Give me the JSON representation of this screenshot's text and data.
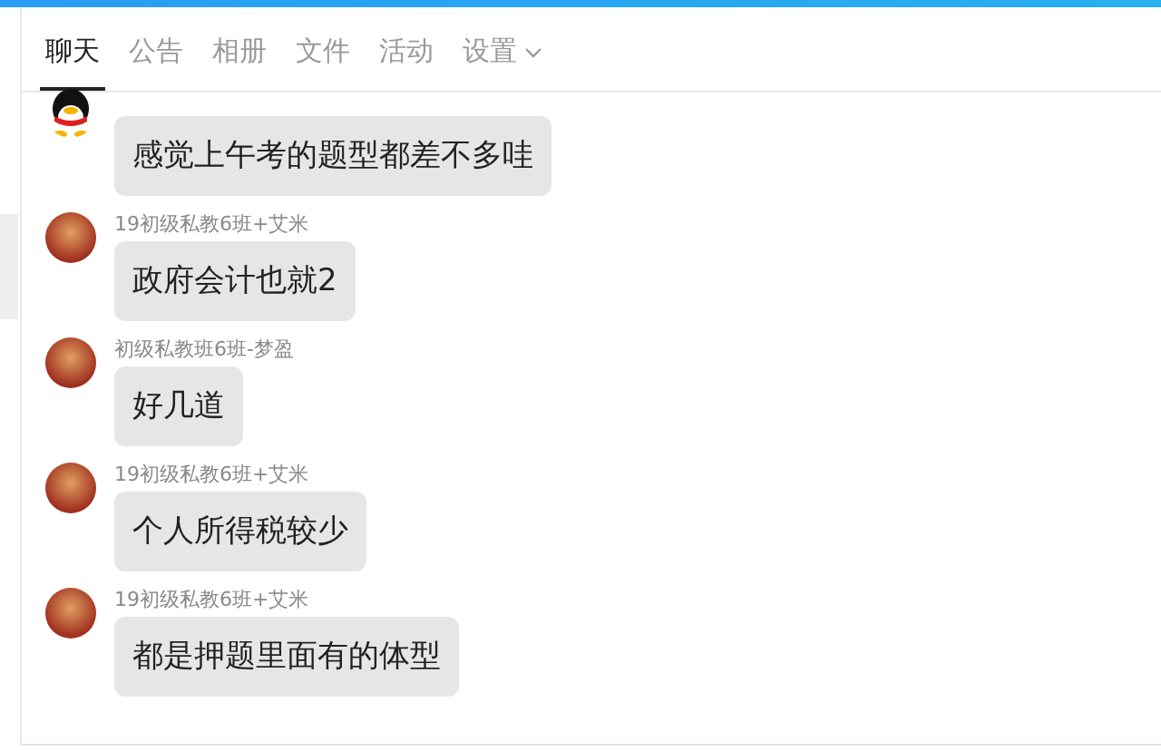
{
  "tabs": [
    {
      "label": "聊天",
      "selected": true,
      "dropdown": false
    },
    {
      "label": "公告",
      "selected": false,
      "dropdown": false
    },
    {
      "label": "相册",
      "selected": false,
      "dropdown": false
    },
    {
      "label": "文件",
      "selected": false,
      "dropdown": false
    },
    {
      "label": "活动",
      "selected": false,
      "dropdown": false
    },
    {
      "label": "设置",
      "selected": false,
      "dropdown": true
    }
  ],
  "messages": [
    {
      "kind": "penguin",
      "text": "感觉上午考的题型都差不多哇"
    },
    {
      "kind": "photo",
      "sender": "19初级私教6班+艾米",
      "text": "政府会计也就2"
    },
    {
      "kind": "photo",
      "sender": "初级私教班6班-梦盈",
      "text": "好几道"
    },
    {
      "kind": "photo",
      "sender": "19初级私教6班+艾米",
      "text": "个人所得税较少"
    },
    {
      "kind": "photo",
      "sender": "19初级私教6班+艾米",
      "text": "都是押题里面有的体型"
    }
  ]
}
